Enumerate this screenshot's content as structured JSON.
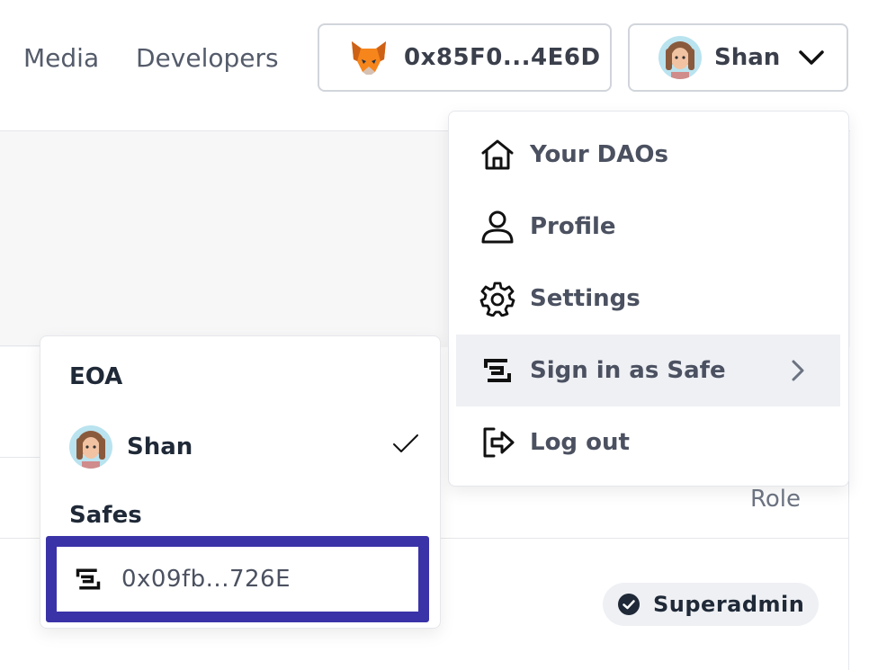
{
  "nav": {
    "media_label": "Media",
    "developers_label": "Developers"
  },
  "wallet": {
    "address": "0x85F0...4E6D",
    "icon": "metamask-fox-icon"
  },
  "user": {
    "name": "Shan",
    "avatar": "user-avatar",
    "chevron": "chevron-down-icon"
  },
  "account_menu": {
    "items": [
      {
        "label": "Your DAOs",
        "icon": "home-icon"
      },
      {
        "label": "Profile",
        "icon": "user-icon"
      },
      {
        "label": "Settings",
        "icon": "gear-icon"
      },
      {
        "label": "Sign in as Safe",
        "icon": "safe-icon",
        "active": true
      },
      {
        "label": "Log out",
        "icon": "logout-icon"
      }
    ]
  },
  "safe_submenu": {
    "eoa_header": "EOA",
    "eoa_name": "Shan",
    "safes_header": "Safes",
    "safe_address": "0x09fb...726E"
  },
  "table": {
    "role_header": "Role",
    "role_badge": "Superadmin"
  },
  "colors": {
    "highlight_border": "#3a33a8",
    "active_item_bg": "#eef0f4"
  }
}
